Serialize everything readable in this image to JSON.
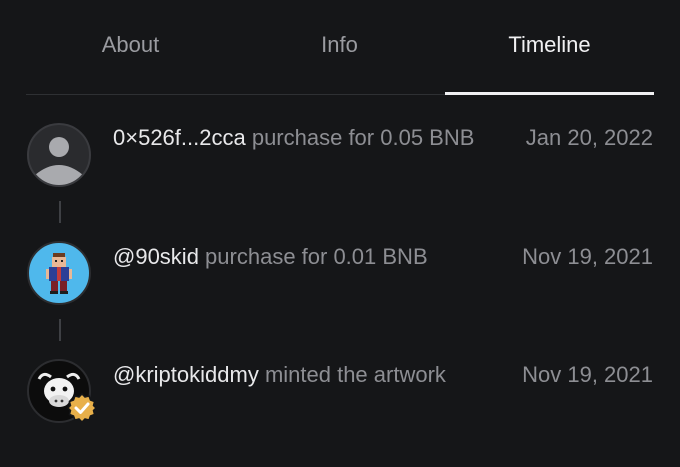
{
  "tabs": [
    {
      "label": "About"
    },
    {
      "label": "Info"
    },
    {
      "label": "Timeline",
      "active": true
    }
  ],
  "timeline": [
    {
      "who": "0×526f...2cca",
      "action": " purchase for 0.05 BNB",
      "date": "Jan 20, 2022",
      "avatar": "default-user-avatar"
    },
    {
      "who": "@90skid",
      "action": " purchase for 0.01 BNB",
      "date": "Nov 19, 2021",
      "avatar": "pixel-character-avatar"
    },
    {
      "who": "@kriptokiddmy",
      "action": " minted the artwork",
      "date": "Nov 19, 2021",
      "avatar": "cow-logo-avatar",
      "verified": true
    }
  ],
  "colors": {
    "background": "#151618",
    "active_tab": "#f0f0f2",
    "verified_badge": "#e8b04a",
    "avatar_sky": "#4fb8ec"
  }
}
